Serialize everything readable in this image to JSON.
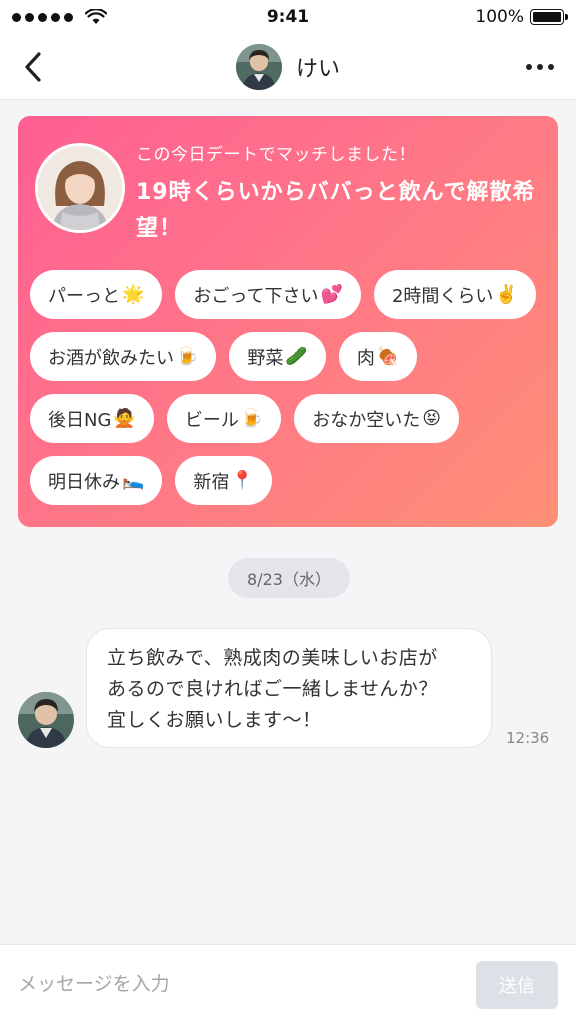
{
  "status_bar": {
    "time": "9:41",
    "battery": "100%"
  },
  "header": {
    "name": "けい"
  },
  "match_card": {
    "subtitle": "この今日デートでマッチしました！",
    "title": "19時くらいからババっと飲んで解散希望！",
    "tags": [
      {
        "label": "パーっと",
        "emoji": "🌟"
      },
      {
        "label": "おごって下さい",
        "emoji": "💕"
      },
      {
        "label": "2時間くらい",
        "emoji": "✌️"
      },
      {
        "label": "お酒が飲みたい",
        "emoji": "🍺"
      },
      {
        "label": "野菜",
        "emoji": "🥒"
      },
      {
        "label": "肉",
        "emoji": "🍖"
      },
      {
        "label": "後日NG",
        "emoji": "🙅"
      },
      {
        "label": "ビール",
        "emoji": "🍺"
      },
      {
        "label": "おなか空いた",
        "emoji": "😝"
      },
      {
        "label": "明日休み",
        "emoji": "🛌"
      },
      {
        "label": "新宿",
        "emoji": "📍"
      }
    ]
  },
  "date_separator": "8/23（水）",
  "messages": [
    {
      "lines": [
        "立ち飲みで、熟成肉の美味しいお店が",
        "あるので良ければご一緒しませんか？",
        "宜しくお願いします〜！"
      ],
      "time": "12:36"
    }
  ],
  "input": {
    "placeholder": "メッセージを入力",
    "send_label": "送信"
  },
  "colors": {
    "card_gradient_start": "#ff5f93",
    "card_gradient_end": "#ff8f76",
    "send_disabled": "#dde0e6"
  }
}
